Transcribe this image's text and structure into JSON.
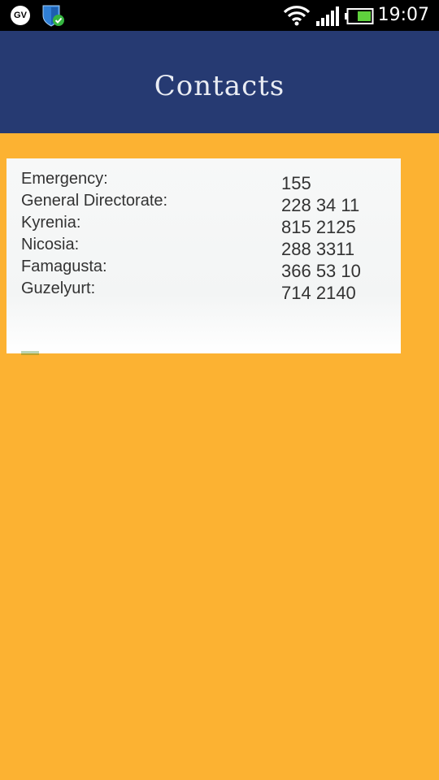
{
  "status_bar": {
    "app_badge": "GV",
    "time": "19:07",
    "icons": [
      "gv-notification-icon",
      "shield-check-icon",
      "wifi-icon",
      "cell-signal-icon",
      "battery-icon"
    ]
  },
  "header": {
    "title": "Contacts",
    "background_color": "#263a72"
  },
  "page": {
    "background_color": "#fcb232"
  },
  "contacts": [
    {
      "name": "Emergency:",
      "number": "155"
    },
    {
      "name": "General Directorate:",
      "number": "228 34 11"
    },
    {
      "name": "Kyrenia:",
      "number": "815 2125"
    },
    {
      "name": "Nicosia:",
      "number": "288 3311"
    },
    {
      "name": "Famagusta:",
      "number": "366 53 10"
    },
    {
      "name": "Guzelyurt:",
      "number": "714 2140"
    }
  ]
}
